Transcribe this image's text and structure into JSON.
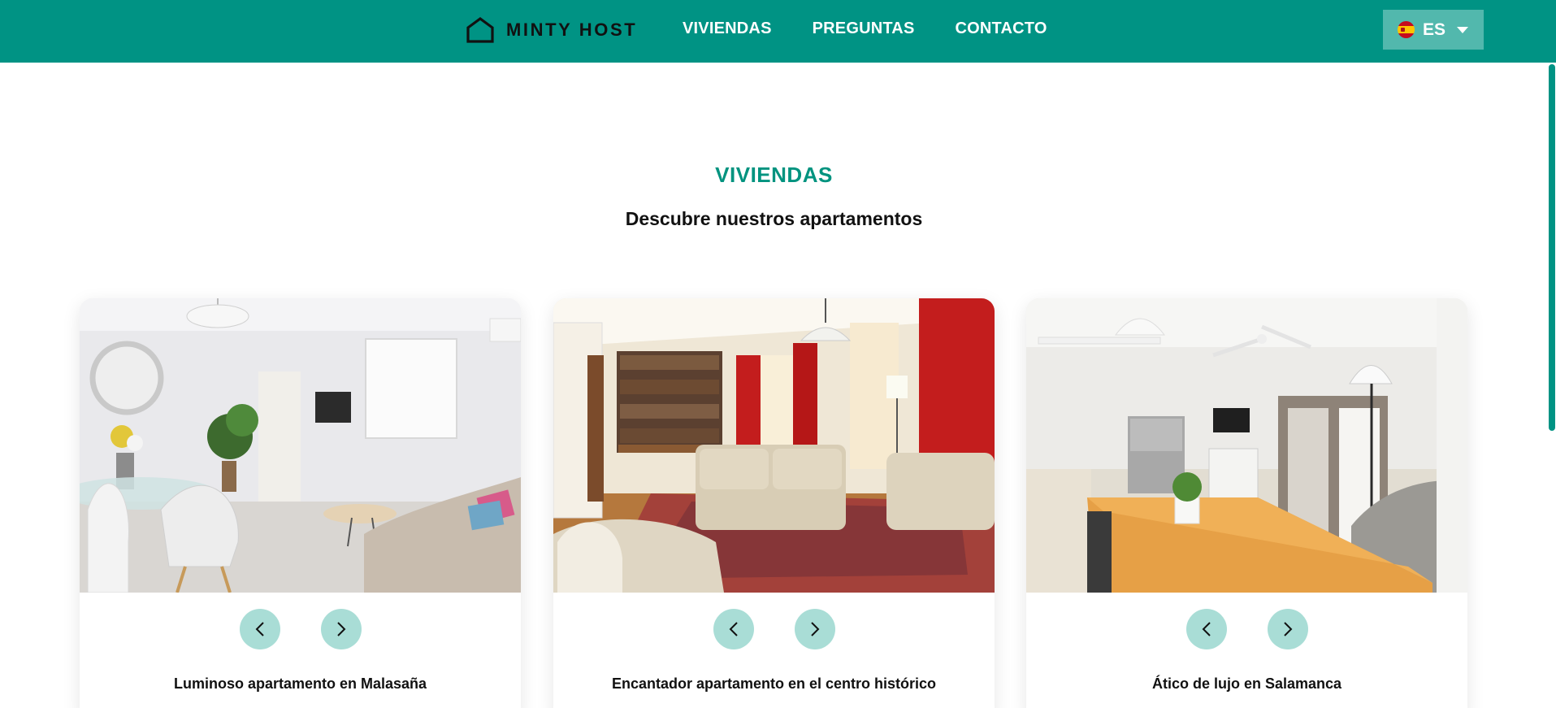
{
  "header": {
    "brand": "MINTY HOST",
    "nav": [
      "VIVIENDAS",
      "PREGUNTAS",
      "CONTACTO"
    ],
    "language": {
      "code": "ES",
      "flag_icon": "spain-flag-icon"
    }
  },
  "section": {
    "title": "VIVIENDAS",
    "subtitle": "Descubre nuestros apartamentos"
  },
  "listings": [
    {
      "title": "Luminoso apartamento en Malasaña"
    },
    {
      "title": "Encantador apartamento en el centro histórico"
    },
    {
      "title": "Ático de lujo en Salamanca"
    }
  ],
  "colors": {
    "brand": "#009384",
    "lang_button": "#52b8ad",
    "arrow_button": "#a9ddd6",
    "heading": "#00937f"
  }
}
